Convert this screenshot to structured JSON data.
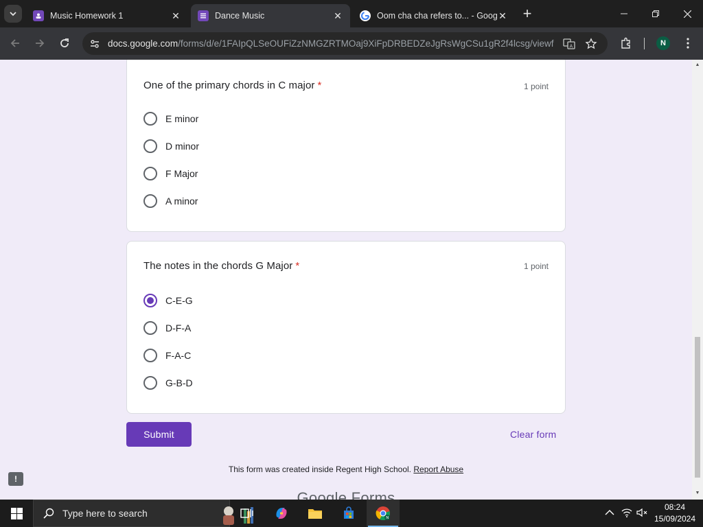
{
  "browser": {
    "tabs": [
      {
        "title": "Music Homework 1",
        "icon": "google-forms-icon",
        "active": false
      },
      {
        "title": "Dance Music",
        "icon": "google-forms-icon",
        "active": true
      },
      {
        "title": "Oom cha cha refers to... - Goog",
        "icon": "google-icon",
        "active": false
      }
    ],
    "url_host": "docs.google.com",
    "url_path": "/forms/d/e/1FAIpQLSeOUFiZzNMGZRTMOaj9XiFpDRBEDZeJgRsWgCSu1gR2f4lcsg/viewf...",
    "profile_initial": "N"
  },
  "form": {
    "questions": [
      {
        "title": "One of the primary chords in C major",
        "required_mark": "*",
        "points": "1 point",
        "options": [
          "E minor",
          "D minor",
          "F Major",
          "A minor"
        ],
        "selected": null
      },
      {
        "title": "The notes in the chords G Major",
        "required_mark": "*",
        "points": "1 point",
        "options": [
          "C-E-G",
          "D-F-A",
          "F-A-C",
          "G-B-D"
        ],
        "selected": "C-E-G"
      }
    ],
    "submit_label": "Submit",
    "clear_label": "Clear form",
    "footer_text": "This form was created inside Regent High School.",
    "report_abuse": "Report Abuse",
    "brand": "Google Forms"
  },
  "taskbar": {
    "search_placeholder": "Type here to search",
    "time": "08:24",
    "date": "15/09/2024"
  },
  "colors": {
    "accent": "#673ab7",
    "page_bg": "#f0ebf8",
    "required": "#d93025"
  }
}
